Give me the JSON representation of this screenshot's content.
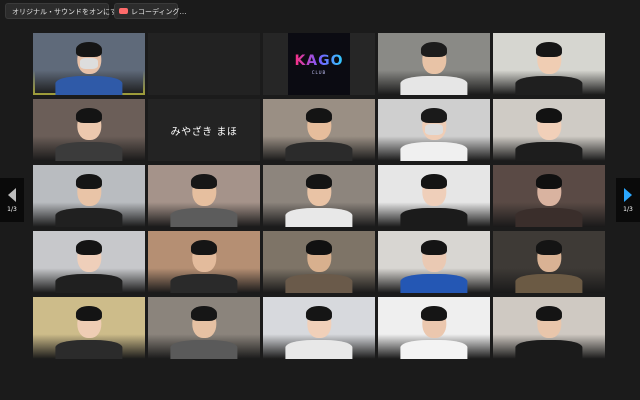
{
  "toolbar": {
    "original_sound_label": "オリジナル・サウンドをオンにする",
    "recording_label": "レコーディング…"
  },
  "pagination": {
    "left_label": "1/3",
    "right_label": "1/3"
  },
  "participants": [
    {
      "kind": "video",
      "colors": {
        "bg": "#5f6a7a",
        "body": "#2f5aa8",
        "head": "#e7c1a8",
        "hair": "#151515"
      },
      "mask": true,
      "active": true
    },
    {
      "kind": "empty"
    },
    {
      "kind": "logo",
      "logo_text": "KAGO",
      "logo_sub": "CLUB"
    },
    {
      "kind": "video",
      "colors": {
        "bg": "#8a8a86",
        "body": "#e6e6e6",
        "head": "#e8c3a6",
        "hair": "#1c1c1c"
      }
    },
    {
      "kind": "video",
      "colors": {
        "bg": "#d6d6d0",
        "body": "#1f1f1f",
        "head": "#f0cdb3",
        "hair": "#161616"
      }
    },
    {
      "kind": "video",
      "colors": {
        "bg": "#6b5e58",
        "body": "#3b3b3b",
        "head": "#ecc8ae",
        "hair": "#141414"
      }
    },
    {
      "kind": "name",
      "name": "みやざき まほ"
    },
    {
      "kind": "video",
      "colors": {
        "bg": "#9a8f84",
        "body": "#2b2b2b",
        "head": "#e6bd9c",
        "hair": "#141414"
      }
    },
    {
      "kind": "video",
      "colors": {
        "bg": "#cfcfcf",
        "body": "#f0f0f0",
        "head": "#efcdb6",
        "hair": "#1a1a1a"
      },
      "mask": true
    },
    {
      "kind": "video",
      "colors": {
        "bg": "#cfcbc5",
        "body": "#1d1d1d",
        "head": "#f1d0b9",
        "hair": "#121212"
      }
    },
    {
      "kind": "video",
      "colors": {
        "bg": "#b9bcc0",
        "body": "#202020",
        "head": "#e9c4a7",
        "hair": "#151515"
      }
    },
    {
      "kind": "video",
      "colors": {
        "bg": "#a5938a",
        "body": "#5c5c5c",
        "head": "#e6bf9f",
        "hair": "#171717"
      }
    },
    {
      "kind": "video",
      "colors": {
        "bg": "#8d857d",
        "body": "#e8e8e8",
        "head": "#e9c3a5",
        "hair": "#141414"
      }
    },
    {
      "kind": "video",
      "colors": {
        "bg": "#e6e6e6",
        "body": "#1b1b1b",
        "head": "#efcfba",
        "hair": "#141414"
      }
    },
    {
      "kind": "video",
      "colors": {
        "bg": "#5a4a45",
        "body": "#3a2e2b",
        "head": "#d9b3a0",
        "hair": "#101010"
      }
    },
    {
      "kind": "video",
      "colors": {
        "bg": "#c7c8cb",
        "body": "#202020",
        "head": "#efcfba",
        "hair": "#141414"
      }
    },
    {
      "kind": "video",
      "colors": {
        "bg": "#b58f73",
        "body": "#2a2a2a",
        "head": "#e3bb9c",
        "hair": "#151515"
      }
    },
    {
      "kind": "video",
      "colors": {
        "bg": "#7e7467",
        "body": "#6a5a4a",
        "head": "#d8b08e",
        "hair": "#111111"
      }
    },
    {
      "kind": "video",
      "colors": {
        "bg": "#d8d6d2",
        "body": "#2457b4",
        "head": "#eac9b3",
        "hair": "#141414"
      }
    },
    {
      "kind": "video",
      "colors": {
        "bg": "#3e3a36",
        "body": "#6b5a44",
        "head": "#d9b294",
        "hair": "#141414"
      }
    },
    {
      "kind": "video",
      "colors": {
        "bg": "#cdbc8a",
        "body": "#2b2b2b",
        "head": "#efcdb4",
        "hair": "#141414"
      }
    },
    {
      "kind": "video",
      "colors": {
        "bg": "#8b847c",
        "body": "#5a5a5a",
        "head": "#e6c1a3",
        "hair": "#161616"
      }
    },
    {
      "kind": "video",
      "colors": {
        "bg": "#d7d9dd",
        "body": "#e8e8e8",
        "head": "#f1d0b9",
        "hair": "#151515"
      }
    },
    {
      "kind": "video",
      "colors": {
        "bg": "#efefef",
        "body": "#f3f3f3",
        "head": "#ebc7ae",
        "hair": "#151515"
      }
    },
    {
      "kind": "video",
      "colors": {
        "bg": "#cfc9c2",
        "body": "#1b1b1b",
        "head": "#e9c6ab",
        "hair": "#141414"
      }
    }
  ]
}
